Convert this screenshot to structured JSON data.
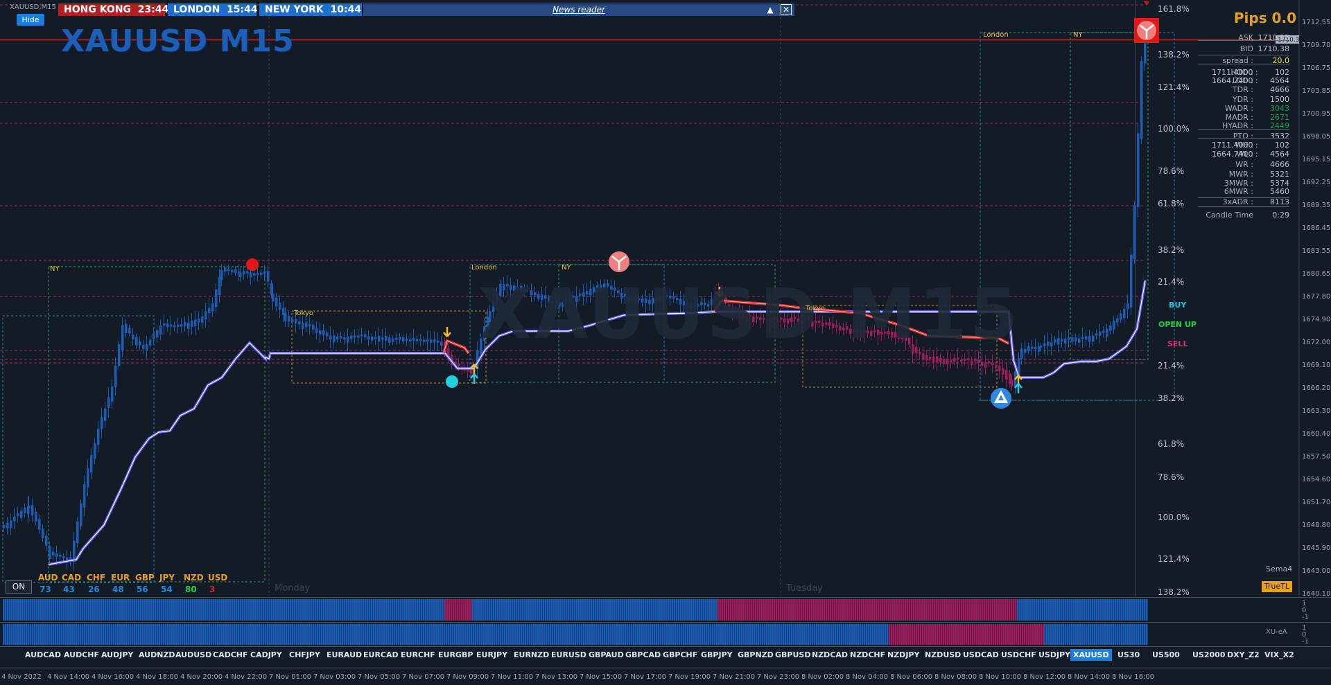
{
  "window": {
    "symbol_tab": "XAUUSD,M15",
    "hide_label": "Hide"
  },
  "clocks": [
    {
      "city": "HONG KONG",
      "time": "23:44",
      "bg": "#b02020"
    },
    {
      "city": "LONDON",
      "time": "15:44",
      "bg": "#1c6fd0"
    },
    {
      "city": "NEW YORK",
      "time": "10:44",
      "bg": "#1c6fd0"
    }
  ],
  "news": {
    "label": "News reader",
    "up_icon": "triangle-up-icon",
    "close_icon": "close-icon"
  },
  "chart": {
    "title": "XAUUSD M15",
    "watermark": "XAUUSD M15",
    "pips_label": "Pips 0.0",
    "sessions": {
      "ny": "NY",
      "london": "London",
      "tokyo": "Tokyo"
    },
    "days": {
      "monday": "Monday",
      "tuesday": "Tuesday"
    },
    "signals": {
      "buy": "BUY",
      "open_up": "OPEN UP",
      "sell": "SELL"
    },
    "sema_label": "Sema4",
    "truetl_label": "TrueTL",
    "on_label": "ON"
  },
  "price_axis": [
    "1712.55",
    "1709.70",
    "1706.75",
    "1703.85",
    "1700.95",
    "1698.05",
    "1695.15",
    "1692.25",
    "1689.35",
    "1686.45",
    "1683.55",
    "1680.65",
    "1677.80",
    "1674.90",
    "1672.00",
    "1669.10",
    "1666.20",
    "1663.30",
    "1660.40",
    "1657.50",
    "1654.60",
    "1651.70",
    "1648.80",
    "1645.90",
    "1643.00",
    "1640.10"
  ],
  "price_tags": {
    "ask": "1710.53",
    "bid": "1710.38"
  },
  "fib_levels": [
    "161.8%",
    "138.2%",
    "121.4%",
    "100.0%",
    "78.6%",
    "61.8%",
    "38.2%",
    "21.4%",
    "21.4%",
    "38.2%",
    "61.8%",
    "78.6%",
    "100.0%",
    "121.4%",
    "138.2%"
  ],
  "info_panel": [
    {
      "k": "ASK",
      "v": "1710.53"
    },
    {
      "k": "BID",
      "v": "1710.38"
    },
    {
      "k": "spread :",
      "v": "20.0",
      "color": "#e8e020"
    },
    {
      "k": "HOD :",
      "v": "1711.4000 :",
      "v2": "102"
    },
    {
      "k": "LOD :",
      "v": "1664.7400 :",
      "v2": "4564"
    },
    {
      "k": "TDR :",
      "v": "4666"
    },
    {
      "k": "YDR :",
      "v": "1500"
    },
    {
      "k": "WADR :",
      "v": "3043",
      "color": "#18a048"
    },
    {
      "k": "MADR :",
      "v": "2671",
      "color": "#18a048"
    },
    {
      "k": "HYADR :",
      "v": "2449",
      "color": "#18a048"
    },
    {
      "k": "PTO :",
      "v": "3532"
    },
    {
      "k": "WH :",
      "v": "1711.4000 :",
      "v2": "102"
    },
    {
      "k": "WL :",
      "v": "1664.7400 :",
      "v2": "4564"
    },
    {
      "k": "WR :",
      "v": "4666"
    },
    {
      "k": "MWR :",
      "v": "5321"
    },
    {
      "k": "3MWR :",
      "v": "5374"
    },
    {
      "k": "6MWR :",
      "v": "5460"
    },
    {
      "k": "3xADR :",
      "v": "8113"
    },
    {
      "k": "Candle Time",
      "v": "0:29"
    }
  ],
  "currency_strength": [
    {
      "name": "AUD",
      "value": "73",
      "color": "#1c8ae0"
    },
    {
      "name": "CAD",
      "value": "43",
      "color": "#1c8ae0"
    },
    {
      "name": "CHF",
      "value": "26",
      "color": "#1c8ae0"
    },
    {
      "name": "EUR",
      "value": "48",
      "color": "#1c8ae0"
    },
    {
      "name": "GBP",
      "value": "56",
      "color": "#1c8ae0"
    },
    {
      "name": "JPY",
      "value": "54",
      "color": "#1c8ae0"
    },
    {
      "name": "NZD",
      "value": "80",
      "color": "#20d040"
    },
    {
      "name": "USD",
      "value": "3",
      "color": "#e02020"
    }
  ],
  "indicator_panels": [
    {
      "name": "",
      "axis": [
        "1",
        "0",
        "-1"
      ]
    },
    {
      "name": "XU-eA",
      "axis": [
        "1",
        "0",
        "-1"
      ]
    }
  ],
  "symbols": [
    "AUDCAD",
    "AUDCHF",
    "AUDJPY",
    "AUDNZD",
    "AUDUSD",
    "CADCHF",
    "CADJPY",
    "CHFJPY",
    "EURAUD",
    "EURCAD",
    "EURCHF",
    "EURGBP",
    "EURJPY",
    "EURNZD",
    "EURUSD",
    "GBPAUD",
    "GBPCAD",
    "GBPCHF",
    "GBPJPY",
    "GBPNZD",
    "GBPUSD",
    "NZDCAD",
    "NZDCHF",
    "NZDJPY",
    "NZDUSD",
    "USDCAD",
    "USDCHF",
    "USDJPY",
    "XAUUSD",
    "US30",
    "US500",
    "US2000",
    "DXY_Z2",
    "VIX_X2"
  ],
  "active_symbol": "XAUUSD",
  "time_axis": [
    "4 Nov 2022",
    "4 Nov 14:00",
    "4 Nov 16:00",
    "4 Nov 18:00",
    "4 Nov 20:00",
    "4 Nov 22:00",
    "7 Nov 01:00",
    "7 Nov 03:00",
    "7 Nov 05:00",
    "7 Nov 07:00",
    "7 Nov 09:00",
    "7 Nov 11:00",
    "7 Nov 13:00",
    "7 Nov 15:00",
    "7 Nov 17:00",
    "7 Nov 19:00",
    "7 Nov 21:00",
    "7 Nov 23:00",
    "8 Nov 02:00",
    "8 Nov 04:00",
    "8 Nov 06:00",
    "8 Nov 08:00",
    "8 Nov 10:00",
    "8 Nov 12:00",
    "8 Nov 14:00",
    "8 Nov 16:00"
  ],
  "colors": {
    "bull": "#1a5db5",
    "bear": "#9c1c5c",
    "trend": "#5a5aff",
    "trend_bear": "#e03030",
    "accent": "#1c7fe0",
    "gold": "#e8a020"
  }
}
